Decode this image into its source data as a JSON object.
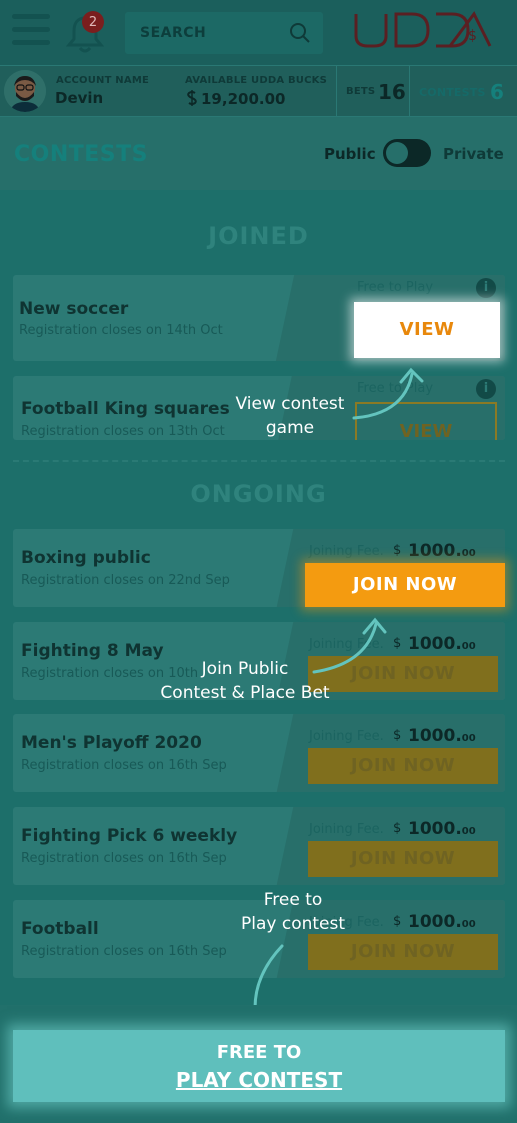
{
  "header": {
    "notification_count": "2",
    "search_placeholder": "SEARCH",
    "logo_text": "UDDA"
  },
  "account": {
    "name_label": "ACCOUNT NAME",
    "name": "Devin",
    "bucks_label": "AVAILABLE UDDA BUCKS",
    "bucks": "19,200.00",
    "bets_label": "BETS",
    "bets_count": "16",
    "contests_label": "CONTESTS",
    "contests_count": "6"
  },
  "subheader": {
    "title": "CONTESTS",
    "public_label": "Public",
    "private_label": "Private"
  },
  "sections": {
    "joined": "JOINED",
    "ongoing": "ONGOING"
  },
  "joined": [
    {
      "name": "New soccer",
      "reg": "Registration closes on 14th Oct",
      "free": "Free to Play",
      "action": "VIEW"
    },
    {
      "name": "Football King squares",
      "reg": "Registration closes on 13th Oct",
      "free": "Free to Play",
      "action": "VIEW"
    }
  ],
  "ongoing": [
    {
      "name": "Boxing public",
      "reg": "Registration closes on 22nd Sep",
      "fee_label": "Joining Fee.",
      "fee": "1000.",
      "fee_cents": "00",
      "action": "JOIN NOW"
    },
    {
      "name": "Fighting 8 May",
      "reg": "Registration closes on 10th",
      "fee_label": "Joining Fee.",
      "fee": "1000.",
      "fee_cents": "00",
      "action": "JOIN NOW"
    },
    {
      "name": "Men's Playoff 2020",
      "reg": "Registration closes on 16th Sep",
      "fee_label": "Joining Fee.",
      "fee": "1000.",
      "fee_cents": "00",
      "action": "JOIN NOW"
    },
    {
      "name": "Fighting Pick 6 weekly",
      "reg": "Registration closes on 16th Sep",
      "fee_label": "Joining Fee.",
      "fee": "1000.",
      "fee_cents": "00",
      "action": "JOIN NOW"
    },
    {
      "name": "Football",
      "reg": "Registration closes on 16th Sep",
      "fee_label": "Joining Fee.",
      "fee": "1000.",
      "fee_cents": "00",
      "action": "JOIN NOW"
    }
  ],
  "tips": {
    "view_l1": "View contest",
    "view_l2": "game",
    "join_l1": "Join Public",
    "join_l2": "Contest & Place Bet",
    "free_l1": "Free to",
    "free_l2": "Play contest"
  },
  "bottom": {
    "line1": "FREE TO",
    "line2": "PLAY CONTEST"
  },
  "colors": {
    "overlay_teal": "#1d6f6a",
    "accent_orange": "#f49b10",
    "accent_cyan": "#5fbfbc"
  }
}
